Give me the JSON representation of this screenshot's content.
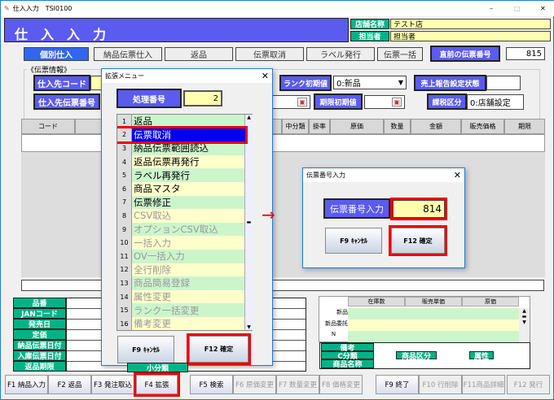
{
  "window": {
    "title": "仕入入力　TSI0100",
    "controls": [
      "–",
      "□",
      "✕"
    ]
  },
  "header": {
    "title": "仕　入　入　力",
    "store_label": "店舗名称",
    "store_value": "テスト店",
    "staff_label": "担当者",
    "staff_value": "担当者"
  },
  "tabs": [
    {
      "label": "個別仕入",
      "active": true
    },
    {
      "label": "納品伝票仕入"
    },
    {
      "label": "返品"
    },
    {
      "label": "伝票取消"
    },
    {
      "label": "ラベル発行"
    },
    {
      "label": "伝票一括"
    }
  ],
  "prev_slip": {
    "label": "直前の伝票番号",
    "value": "815"
  },
  "slip_info": {
    "group_label": "《伝票情報》",
    "supplier_code_label": "仕入先コード",
    "supplier_slip_label": "仕入先伝票番号",
    "rank_label": "ランク初期値",
    "rank_value": "0:新品",
    "sales_report_label": "売上報告設定状態",
    "expiry_label": "期限初期値",
    "tax_label": "課税区分",
    "tax_value": "0:店舗設定"
  },
  "grid": {
    "headers": [
      "コード",
      "中分類",
      "掛率",
      "原価",
      "数量",
      "金額",
      "販売価格",
      "期限"
    ]
  },
  "detail": {
    "labels": [
      "品番",
      "JANコード",
      "発売日",
      "定価",
      "納品伝票日付",
      "入庫伝票日付",
      "返品期限"
    ],
    "sub_class_label": "小分類"
  },
  "stock_table": {
    "headers": [
      "在庫数",
      "販売単価",
      "原価"
    ],
    "rows": [
      "新品",
      "新品委託",
      "N"
    ]
  },
  "extra": {
    "note_label": "備考",
    "c_class_label": "C分類",
    "product_type_label": "商品区分",
    "attribute_label": "属性",
    "product_name_label": "商品名称"
  },
  "fkeys": [
    {
      "label": "F1 納品入力"
    },
    {
      "label": "F2 返品"
    },
    {
      "label": "F3 発注取込"
    },
    {
      "label": "F4 拡張",
      "highlight": true
    },
    {
      "label": "F5 検索"
    },
    {
      "label": "F6 原価変更",
      "disabled": true
    },
    {
      "label": "F7 数量変更",
      "disabled": true
    },
    {
      "label": "F8 価格変更",
      "disabled": true
    },
    {
      "label": "F9 終了"
    },
    {
      "label": "F10 行削除",
      "disabled": true
    },
    {
      "label": "F11商品詳細",
      "disabled": true
    },
    {
      "label": "F12 発行",
      "disabled": true
    }
  ],
  "ext_menu": {
    "title": "拡張メニュー",
    "proc_label": "処理番号",
    "proc_value": "2",
    "items": [
      {
        "n": "1",
        "label": "返品"
      },
      {
        "n": "2",
        "label": "伝票取消",
        "selected": true
      },
      {
        "n": "3",
        "label": "納品伝票範囲読込"
      },
      {
        "n": "4",
        "label": "返品伝票再発行"
      },
      {
        "n": "5",
        "label": "ラベル再発行"
      },
      {
        "n": "6",
        "label": "商品マスタ"
      },
      {
        "n": "7",
        "label": "伝票修正"
      },
      {
        "n": "8",
        "label": "CSV取込",
        "disabled": true
      },
      {
        "n": "9",
        "label": "オプションCSV取込",
        "disabled": true
      },
      {
        "n": "10",
        "label": "一括入力",
        "disabled": true
      },
      {
        "n": "11",
        "label": "OV一括入力",
        "disabled": true
      },
      {
        "n": "12",
        "label": "全行削除",
        "disabled": true
      },
      {
        "n": "13",
        "label": "商品簡易登録",
        "disabled": true
      },
      {
        "n": "14",
        "label": "属性変更",
        "disabled": true
      },
      {
        "n": "15",
        "label": "ランク一括変更",
        "disabled": true
      },
      {
        "n": "16",
        "label": "備考変更",
        "disabled": true
      }
    ],
    "cancel_label": "F9 ｷｬﾝｾﾙ",
    "ok_label": "F12 確定"
  },
  "slip_dialog": {
    "title": "伝票番号入力",
    "label": "伝票番号入力",
    "value": "814",
    "cancel_label": "F9 ｷｬﾝｾﾙ",
    "ok_label": "F12 確定"
  },
  "colors": {
    "label_blue": "#5b5bf0",
    "label_green": "#00b386",
    "highlight_red": "#e00000",
    "selected_blue": "#0000ee"
  }
}
